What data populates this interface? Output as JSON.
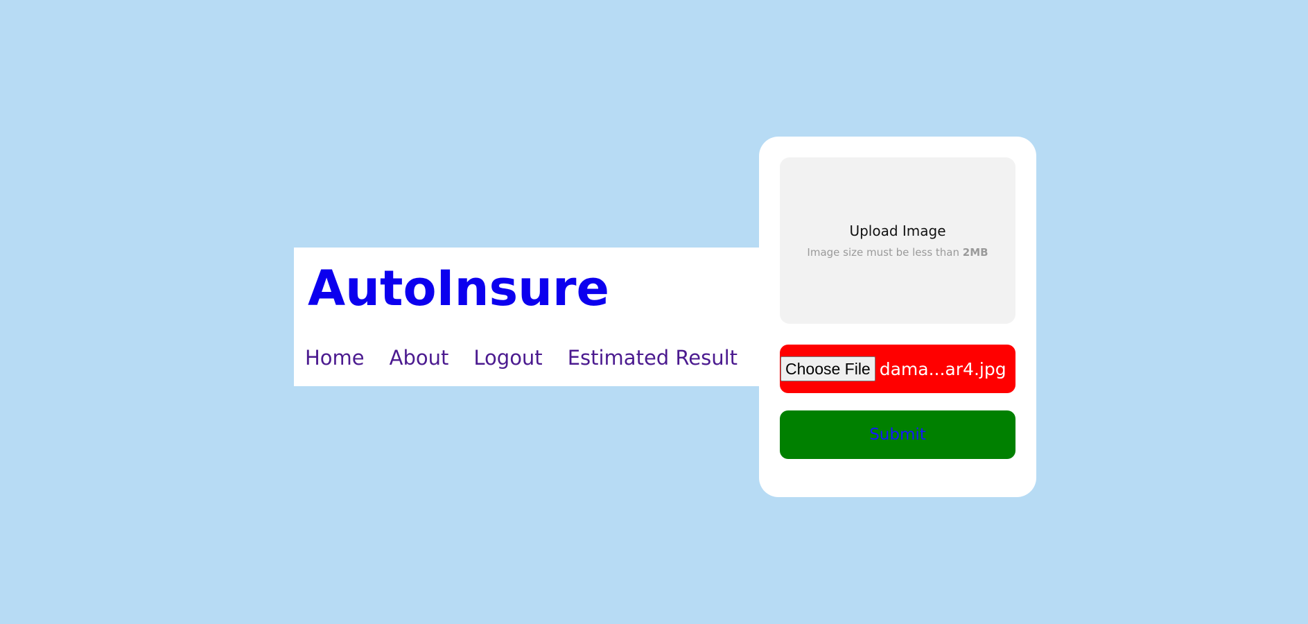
{
  "header": {
    "brand": "AutoInsure",
    "nav": [
      {
        "label": "Home"
      },
      {
        "label": "About"
      },
      {
        "label": "Logout"
      },
      {
        "label": "Estimated Result"
      }
    ]
  },
  "upload": {
    "title": "Upload Image",
    "hint_prefix": "Image size must be less than",
    "hint_limit": "2MB",
    "choose_file_label": "Choose File",
    "file_name": "dama...ar4.jpg",
    "submit_label": "Submit"
  },
  "colors": {
    "background": "#b7dbf4",
    "brand": "#0c00ee",
    "nav_link": "#4b1a8f",
    "file_row": "#ff0000",
    "submit_bg": "#008000",
    "submit_text": "#1616ff"
  }
}
